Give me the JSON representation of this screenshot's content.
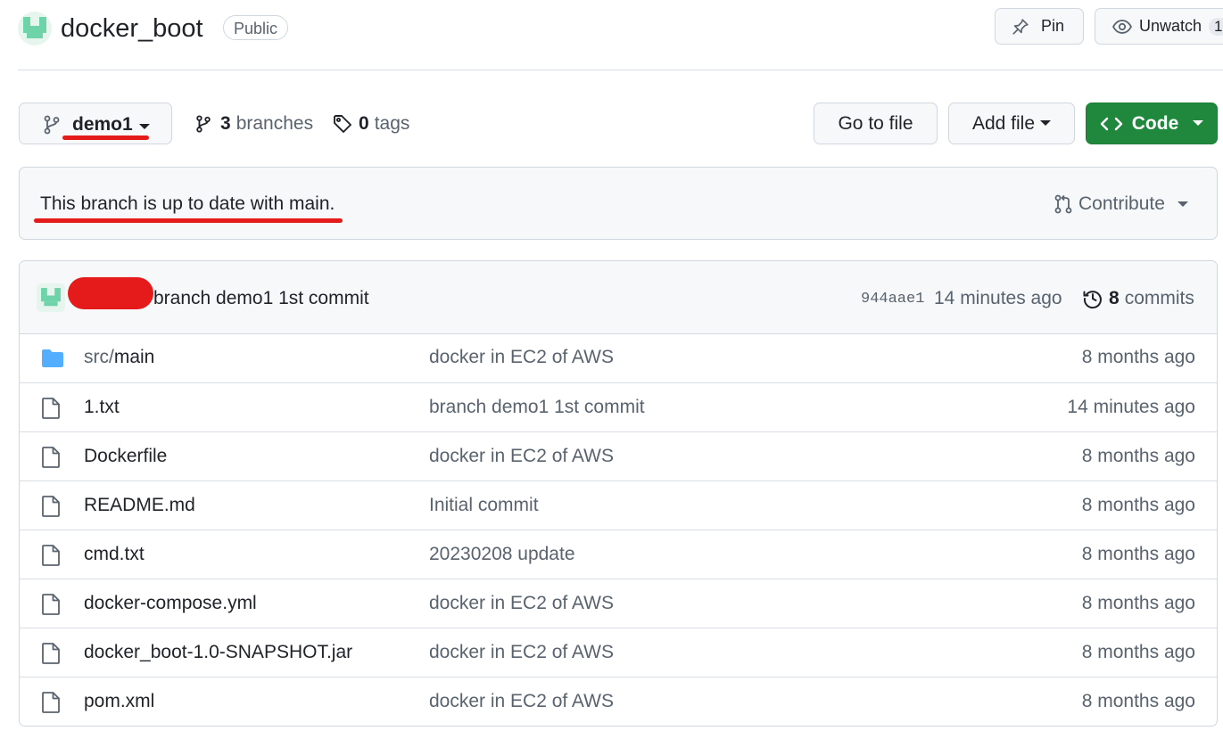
{
  "repo": {
    "name": "docker_boot",
    "visibility": "Public",
    "pin_label": "Pin",
    "unwatch_label": "Unwatch",
    "watch_count": "1"
  },
  "branch_bar": {
    "current_branch": "demo1",
    "branches_count": "3",
    "branches_label": "branches",
    "tags_count": "0",
    "tags_label": "tags",
    "go_to_file_label": "Go to file",
    "add_file_label": "Add file",
    "code_label": "Code"
  },
  "status": {
    "text": "This branch is up to date with main.",
    "contribute_label": "Contribute"
  },
  "last_commit": {
    "message": "branch demo1 1st commit",
    "sha": "944aae1",
    "age": "14 minutes ago",
    "commits_count": "8",
    "commits_label": "commits"
  },
  "files": [
    {
      "type": "folder",
      "name_prefix": "src/",
      "name": "main",
      "message": "docker in EC2 of AWS",
      "age": "8 months ago"
    },
    {
      "type": "file",
      "name_prefix": "",
      "name": "1.txt",
      "message": "branch demo1 1st commit",
      "age": "14 minutes ago"
    },
    {
      "type": "file",
      "name_prefix": "",
      "name": "Dockerfile",
      "message": "docker in EC2 of AWS",
      "age": "8 months ago"
    },
    {
      "type": "file",
      "name_prefix": "",
      "name": "README.md",
      "message": "Initial commit",
      "age": "8 months ago"
    },
    {
      "type": "file",
      "name_prefix": "",
      "name": "cmd.txt",
      "message": "20230208 update",
      "age": "8 months ago"
    },
    {
      "type": "file",
      "name_prefix": "",
      "name": "docker-compose.yml",
      "message": "docker in EC2 of AWS",
      "age": "8 months ago"
    },
    {
      "type": "file",
      "name_prefix": "",
      "name": "docker_boot-1.0-SNAPSHOT.jar",
      "message": "docker in EC2 of AWS",
      "age": "8 months ago"
    },
    {
      "type": "file",
      "name_prefix": "",
      "name": "pom.xml",
      "message": "docker in EC2 of AWS",
      "age": "8 months ago"
    }
  ],
  "colors": {
    "accent_green": "#1f883d",
    "highlight_red": "#e51b1b",
    "folder_blue": "#54aeff",
    "avatar_green": "#6fd3a9"
  }
}
